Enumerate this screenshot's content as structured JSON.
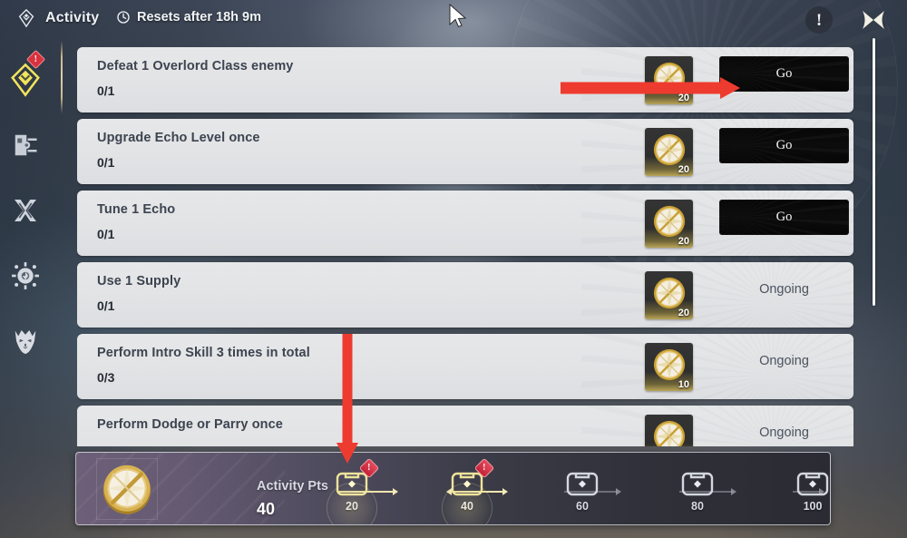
{
  "header": {
    "title": "Activity",
    "title_icon": "activity-diamond-icon",
    "reset_icon": "clock-icon",
    "reset_text": "Resets after 18h 9m",
    "info_label": "!",
    "close_label": "close-x-icon"
  },
  "sidebar": {
    "items": [
      {
        "name": "activity",
        "icon": "activity-diamond-icon",
        "active": true,
        "badge": "!"
      },
      {
        "name": "missions",
        "icon": "mission-card-icon",
        "active": false,
        "badge": ""
      },
      {
        "name": "combat",
        "icon": "crossed-blades-icon",
        "active": false,
        "badge": ""
      },
      {
        "name": "exploration",
        "icon": "sun-compass-icon",
        "active": false,
        "badge": ""
      },
      {
        "name": "boss",
        "icon": "oni-mask-icon",
        "active": false,
        "badge": ""
      }
    ]
  },
  "tasks": [
    {
      "name": "Defeat 1 Overlord Class enemy",
      "progress": "0/1",
      "reward_icon": "activity-pts-medallion",
      "reward_count": "20",
      "action": "Go",
      "state": "go"
    },
    {
      "name": "Upgrade Echo Level once",
      "progress": "0/1",
      "reward_icon": "activity-pts-medallion",
      "reward_count": "20",
      "action": "Go",
      "state": "go"
    },
    {
      "name": "Tune 1 Echo",
      "progress": "0/1",
      "reward_icon": "activity-pts-medallion",
      "reward_count": "20",
      "action": "Go",
      "state": "go"
    },
    {
      "name": "Use 1 Supply",
      "progress": "0/1",
      "reward_icon": "activity-pts-medallion",
      "reward_count": "20",
      "action": "Ongoing",
      "state": "ongoing"
    },
    {
      "name": "Perform Intro Skill 3 times in total",
      "progress": "0/3",
      "reward_icon": "activity-pts-medallion",
      "reward_count": "10",
      "action": "Ongoing",
      "state": "ongoing"
    },
    {
      "name": "Perform Dodge or Parry once",
      "progress": "",
      "reward_icon": "activity-pts-medallion",
      "reward_count": "",
      "action": "Ongoing",
      "state": "ongoing"
    }
  ],
  "progress_panel": {
    "icon": "activity-pts-medallion",
    "label": "Activity Pts",
    "value": "40",
    "milestones": [
      {
        "value": "20",
        "state": "claimable",
        "badge": "!"
      },
      {
        "value": "40",
        "state": "claimable",
        "badge": "!"
      },
      {
        "value": "60",
        "state": "locked",
        "badge": ""
      },
      {
        "value": "80",
        "state": "locked",
        "badge": ""
      },
      {
        "value": "100",
        "state": "locked",
        "badge": ""
      }
    ]
  },
  "annotations": [
    {
      "name": "arrow-to-go-button",
      "direction": "right",
      "color": "#ee3b2f"
    },
    {
      "name": "arrow-to-milestone-20",
      "direction": "down",
      "color": "#ee3b2f"
    }
  ],
  "colors": {
    "accent_gold": "#c9b98d",
    "alert_red": "#d8323f",
    "annotation_red": "#ee3b2f",
    "card_bg": "#e4e5e7",
    "go_button_bg": "#0a0a0a"
  }
}
